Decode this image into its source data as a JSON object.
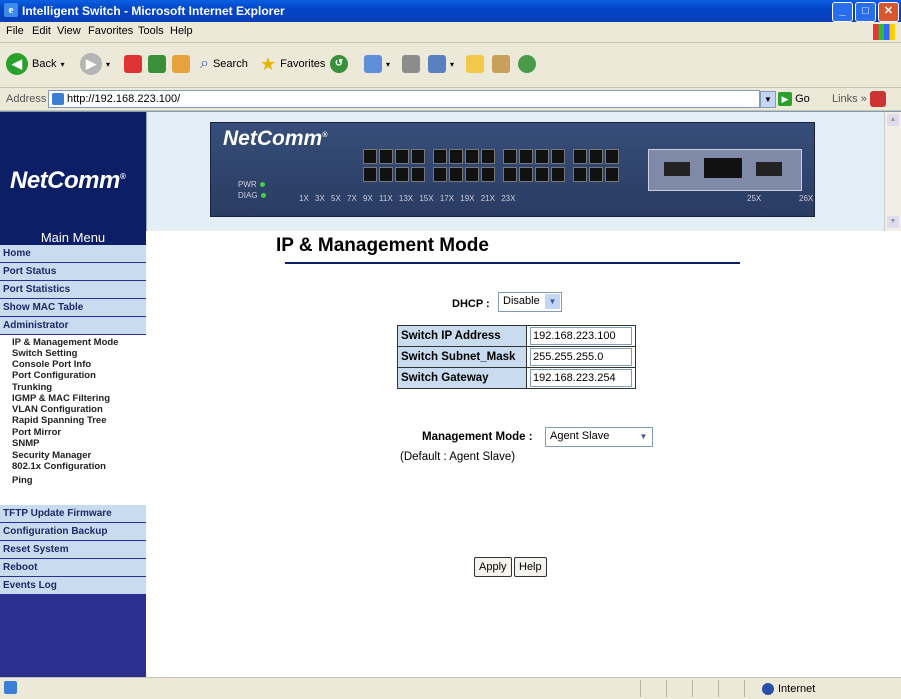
{
  "window": {
    "title": "Intelligent Switch - Microsoft Internet Explorer"
  },
  "menubar": [
    "File",
    "Edit",
    "View",
    "Favorites",
    "Tools",
    "Help"
  ],
  "toolbar": {
    "back": "Back",
    "search": "Search",
    "favorites": "Favorites"
  },
  "address": {
    "label": "Address",
    "url": "http://192.168.223.100/",
    "go": "Go",
    "links": "Links"
  },
  "banner": {
    "logo": "NetComm",
    "switch_brand": "NetComm",
    "pwr": "PWR",
    "diag": "DIAG",
    "port_labels": "1X 3X 5X 7X 9X 11X 13X 15X 17X 19X 21X 23X",
    "port25": "25X",
    "port26": "26X"
  },
  "sidebar": {
    "title": "Main Menu",
    "items": [
      "Home",
      "Port Status",
      "Port Statistics",
      "Show MAC Table",
      "Administrator"
    ],
    "sub_items": [
      "IP & Management Mode",
      "Switch Setting",
      "Console Port Info",
      "Port Configuration",
      "Trunking",
      "IGMP & MAC Filtering",
      "VLAN Configuration",
      "Rapid Spanning Tree",
      "Port Mirror",
      "SNMP",
      "Security Manager",
      "802.1x Configuration",
      "Ping"
    ],
    "bottom_items": [
      "TFTP Update Firmware",
      "Configuration Backup",
      "Reset System",
      "Reboot",
      "Events Log"
    ]
  },
  "main": {
    "title": "IP & Management Mode",
    "dhcp_label": "DHCP :",
    "dhcp_value": "Disable",
    "ip_table": [
      {
        "label": "Switch IP Address",
        "value": "192.168.223.100"
      },
      {
        "label": "Switch Subnet_Mask",
        "value": "255.255.255.0"
      },
      {
        "label": "Switch Gateway",
        "value": "192.168.223.254"
      }
    ],
    "mgmt_label": "Management Mode :",
    "mgmt_value": "Agent Slave",
    "default_note": "(Default : Agent Slave)",
    "apply": "Apply",
    "help": "Help"
  },
  "statusbar": {
    "zone": "Internet"
  }
}
